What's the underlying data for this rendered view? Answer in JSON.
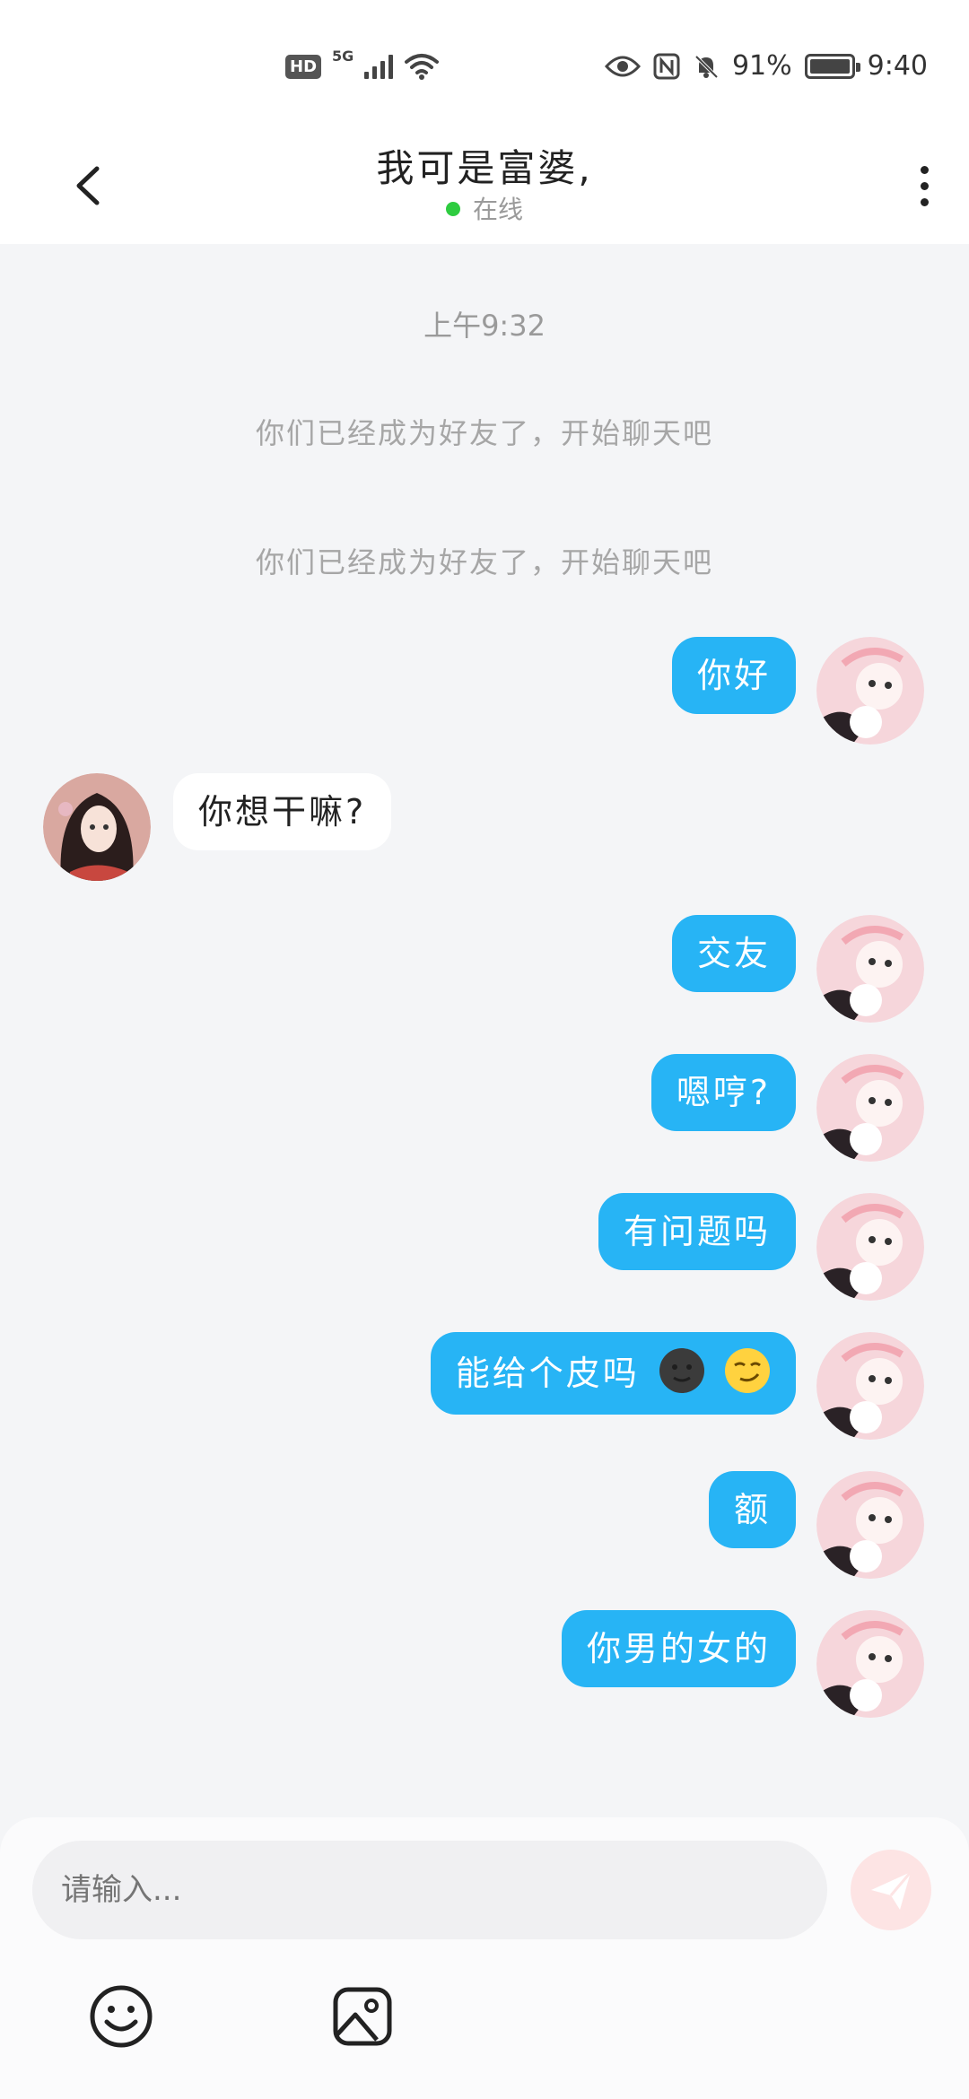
{
  "status_bar": {
    "hd": "HD",
    "network": "5G",
    "battery_percent": "91%",
    "time": "9:40"
  },
  "header": {
    "title": "我可是富婆,",
    "status": "在线"
  },
  "chat": {
    "timestamp": "上午9:32",
    "system_messages": [
      "你们已经成为好友了，开始聊天吧",
      "你们已经成为好友了，开始聊天吧"
    ],
    "messages": [
      {
        "side": "right",
        "text": "你好"
      },
      {
        "side": "left",
        "text": "你想干嘛?"
      },
      {
        "side": "right",
        "text": "交友"
      },
      {
        "side": "right",
        "text": "嗯哼?"
      },
      {
        "side": "right",
        "text": "有问题吗"
      },
      {
        "side": "right",
        "text": "能给个皮吗",
        "emojis": [
          "new-moon-face-icon",
          "smirk-face-icon"
        ]
      },
      {
        "side": "right",
        "text": "额"
      },
      {
        "side": "right",
        "text": "你男的女的"
      }
    ]
  },
  "composer": {
    "placeholder": "请输入..."
  },
  "colors": {
    "accent": "#27b4f5",
    "online": "#2ecc40",
    "send_disabled": "#fde4e4"
  }
}
